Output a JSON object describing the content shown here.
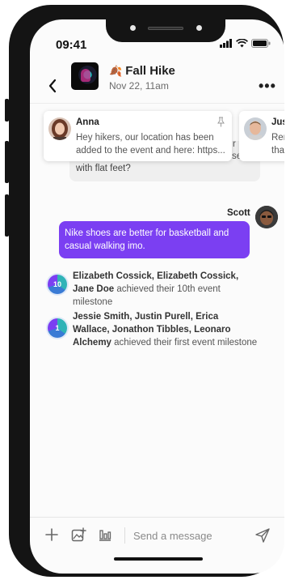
{
  "status_bar": {
    "time": "09:41"
  },
  "header": {
    "title": "Fall Hike",
    "title_emoji": "🍂",
    "subtitle": "Nov 22, 11am"
  },
  "pinned": [
    {
      "name": "Anna",
      "text": "Hey hikers, our location has been added to the event and here: https..."
    },
    {
      "name": "Jus",
      "text": "Rem that"
    }
  ],
  "chat": {
    "partial_message_tail": "with flat feet?",
    "hidden_fragments": [
      "r",
      "se"
    ],
    "sent_message": {
      "sender": "Scott",
      "text": "Nike shoes are better for basketball and casual walking imo."
    },
    "milestones": [
      {
        "badge": "10",
        "names": "Elizabeth Cossick, Elizabeth Cossick, Jane Doe",
        "suffix": " achieved their 10th event milestone"
      },
      {
        "badge": "1",
        "names": "Jessie Smith, Justin Purell, Erica Wallace, Jonathon Tibbles, Leonaro Alchemy",
        "suffix": " achieved their first event milestone"
      }
    ]
  },
  "composer": {
    "placeholder": "Send a message"
  },
  "colors": {
    "accent": "#7b3ff2",
    "leaf": "#c8731f"
  }
}
